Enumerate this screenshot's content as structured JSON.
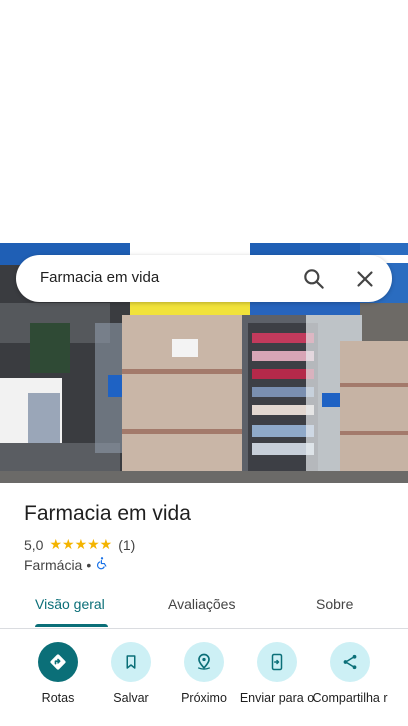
{
  "search": {
    "query": "Farmacia em vida"
  },
  "place": {
    "name": "Farmacia em vida",
    "rating": "5,0",
    "stars": "★★★★★",
    "review_count": "(1)",
    "category": "Farmácia",
    "separator": "•"
  },
  "tabs": [
    {
      "label": "Visão geral",
      "active": true
    },
    {
      "label": "Avaliações",
      "active": false
    },
    {
      "label": "Sobre",
      "active": false
    }
  ],
  "actions": [
    {
      "label": "Rotas",
      "icon": "directions-icon"
    },
    {
      "label": "Salvar",
      "icon": "bookmark-icon"
    },
    {
      "label": "Próximo",
      "icon": "nearby-icon"
    },
    {
      "label": "Enviar para o",
      "icon": "send-to-phone-icon"
    },
    {
      "label": "Compartilha r",
      "icon": "share-icon"
    }
  ],
  "colors": {
    "accent": "#0b6f78",
    "action_bg": "#cdf0f5",
    "star": "#f4b400",
    "accessibility": "#1a73e8"
  }
}
